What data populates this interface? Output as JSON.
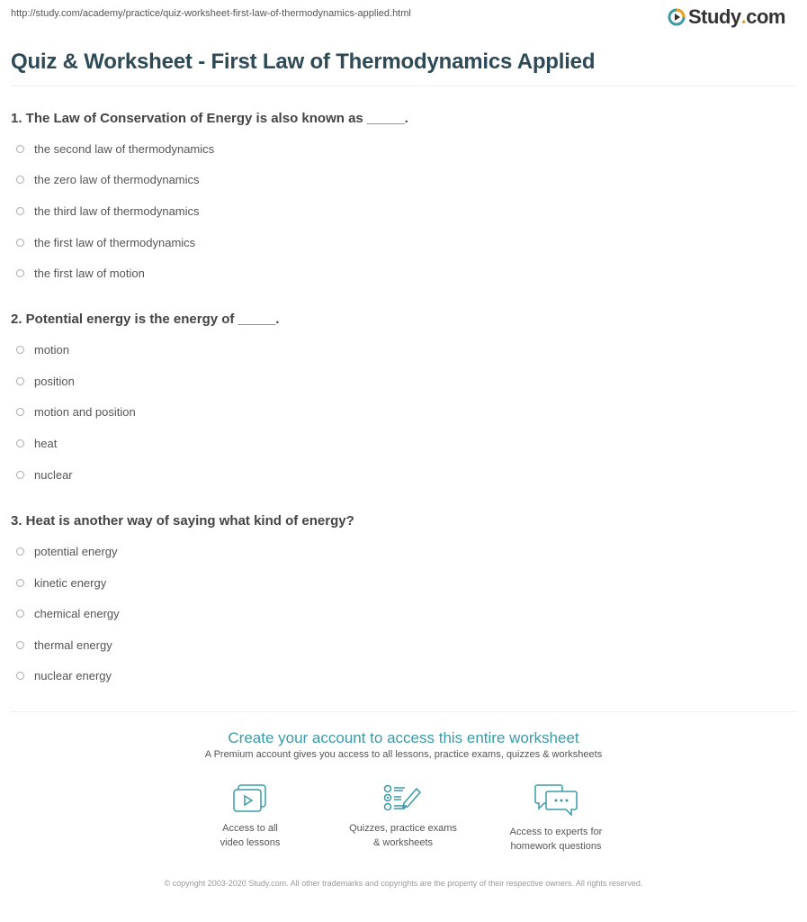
{
  "url": "http://study.com/academy/practice/quiz-worksheet-first-law-of-thermodynamics-applied.html",
  "logo": {
    "brand": "Study",
    "dot": ".",
    "tld": "com"
  },
  "title": "Quiz & Worksheet - First Law of Thermodynamics Applied",
  "questions": [
    {
      "text": "1. The Law of Conservation of Energy is also known as _____.",
      "options": [
        "the second law of thermodynamics",
        "the zero law of thermodynamics",
        "the third law of thermodynamics",
        "the first law of thermodynamics",
        "the first law of motion"
      ]
    },
    {
      "text": "2. Potential energy is the energy of _____.",
      "options": [
        "motion",
        "position",
        "motion and position",
        "heat",
        "nuclear"
      ]
    },
    {
      "text": "3. Heat is another way of saying what kind of energy?",
      "options": [
        "potential energy",
        "kinetic energy",
        "chemical energy",
        "thermal energy",
        "nuclear energy"
      ]
    }
  ],
  "cta": {
    "title": "Create your account to access this entire worksheet",
    "subtitle": "A Premium account gives you access to all lessons, practice exams, quizzes & worksheets",
    "features": [
      {
        "icon": "video-icon",
        "line1": "Access to all",
        "line2": "video lessons"
      },
      {
        "icon": "quiz-icon",
        "line1": "Quizzes, practice exams",
        "line2": "& worksheets"
      },
      {
        "icon": "chat-icon",
        "line1": "Access to experts for",
        "line2": "homework questions"
      }
    ],
    "accent": "#3a9aa8"
  },
  "copyright": "© copyright 2003-2020 Study.com. All other trademarks and copyrights are the property of their respective owners. All rights reserved."
}
